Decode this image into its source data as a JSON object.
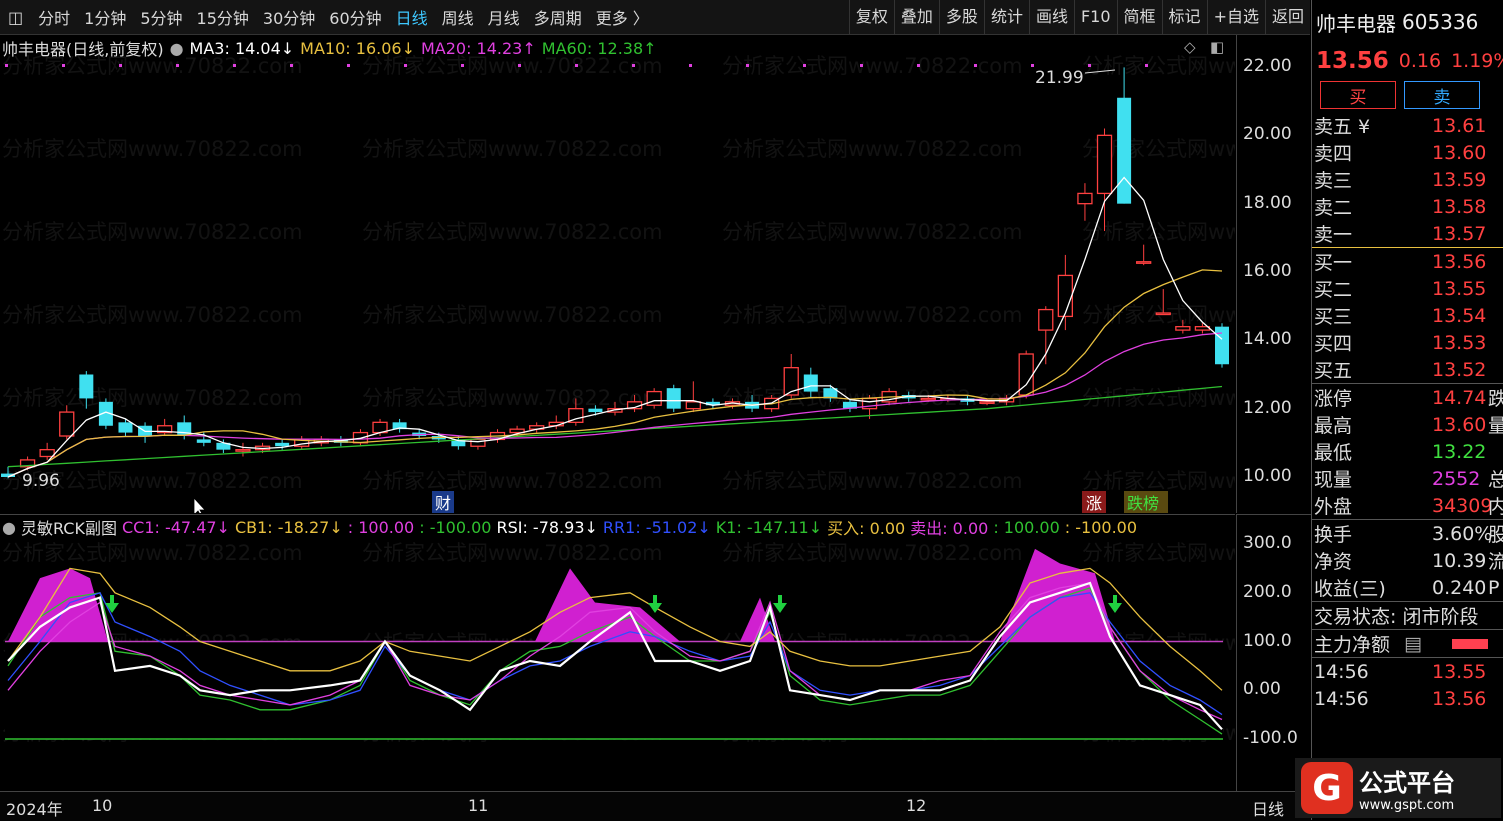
{
  "toolbar": {
    "left_items": [
      "分时",
      "1分钟",
      "5分钟",
      "15分钟",
      "30分钟",
      "60分钟",
      "日线",
      "周线",
      "月线",
      "多周期",
      "更多 〉"
    ],
    "active_item": "日线",
    "right_items": [
      "复权",
      "叠加",
      "多股",
      "统计",
      "画线",
      "F10",
      "简框",
      "标记",
      "+自选",
      "返回"
    ]
  },
  "main_legend": {
    "title": "帅丰电器(日线,前复权)",
    "ma3": "MA3: 14.04↓",
    "ma10": "MA10: 16.06↓",
    "ma20": "MA20: 14.23↑",
    "ma60": "MA60: 12.38↑"
  },
  "colors": {
    "ma3": "#ffffff",
    "ma10": "#e8c040",
    "ma20": "#e040e0",
    "ma60": "#30c030",
    "up": "#ff4040",
    "down": "#40e0f0",
    "rsi": "#ffffff"
  },
  "main_axis": {
    "ticks": [
      "22.00",
      "20.00",
      "18.00",
      "16.00",
      "14.00",
      "12.00",
      "10.00"
    ]
  },
  "annotations": {
    "high": "21.99",
    "low": "9.96",
    "cai": "财",
    "zhang": "涨",
    "dieban": "跌榜"
  },
  "sub_legend": {
    "title": "灵敏RCK副图",
    "cc1": "CC1: -47.47↓",
    "cb1": "CB1: -18.27↓",
    "l100": ": 100.00",
    "lm100": ": -100.00",
    "rsi": "RSI: -78.93↓",
    "rr1": "RR1: -51.02↓",
    "k1": "K1: -147.11↓",
    "buy": "买入: 0.00",
    "sell": "卖出: 0.00",
    "p100": ": 100.00",
    "m100": ": -100.00"
  },
  "sub_axis": {
    "ticks": [
      "300.0",
      "200.0",
      "100.0",
      "0.00",
      "-100.0"
    ]
  },
  "x_axis": {
    "labels": [
      "2024年",
      "10",
      "11",
      "12"
    ],
    "period": "日线"
  },
  "right_panel": {
    "name": "帅丰电器",
    "code": "605336",
    "price": "13.56",
    "change": "0.16",
    "change_pct": "1.19%",
    "buy_label": "买",
    "sell_label": "卖",
    "asks": [
      {
        "label": "卖五 ¥",
        "price": "13.61"
      },
      {
        "label": "卖四",
        "price": "13.60"
      },
      {
        "label": "卖三",
        "price": "13.59"
      },
      {
        "label": "卖二",
        "price": "13.58"
      },
      {
        "label": "卖一",
        "price": "13.57"
      }
    ],
    "bids": [
      {
        "label": "买一",
        "price": "13.56"
      },
      {
        "label": "买二",
        "price": "13.55"
      },
      {
        "label": "买三",
        "price": "13.54"
      },
      {
        "label": "买四",
        "price": "13.53"
      },
      {
        "label": "买五",
        "price": "13.52"
      }
    ],
    "stats": [
      {
        "label": "涨停",
        "value": "14.74",
        "extra": "跌",
        "color": "#ff4040"
      },
      {
        "label": "最高",
        "value": "13.60",
        "extra": "量",
        "color": "#ff4040"
      },
      {
        "label": "最低",
        "value": "13.22",
        "extra": "",
        "color": "#40e040"
      },
      {
        "label": "现量",
        "value": "2552",
        "extra": "总",
        "color": "#e040e0"
      },
      {
        "label": "外盘",
        "value": "34309",
        "extra": "内",
        "color": "#ff4040"
      }
    ],
    "stats2": [
      {
        "label": "换手",
        "value": "3.60%",
        "extra": "股"
      },
      {
        "label": "净资",
        "value": "10.39",
        "extra": "流"
      },
      {
        "label": "收益(三)",
        "value": "0.240",
        "extra": "P"
      }
    ],
    "trade_status": "交易状态: 闭市阶段",
    "main_net": "主力净额",
    "ticks": [
      {
        "time": "14:56",
        "price": "13.55"
      },
      {
        "time": "14:56",
        "price": "13.56"
      }
    ]
  },
  "watermark": "分析家公式网www.70822.com",
  "logo": {
    "text": "公式平台",
    "url": "www.gspt.com"
  }
}
